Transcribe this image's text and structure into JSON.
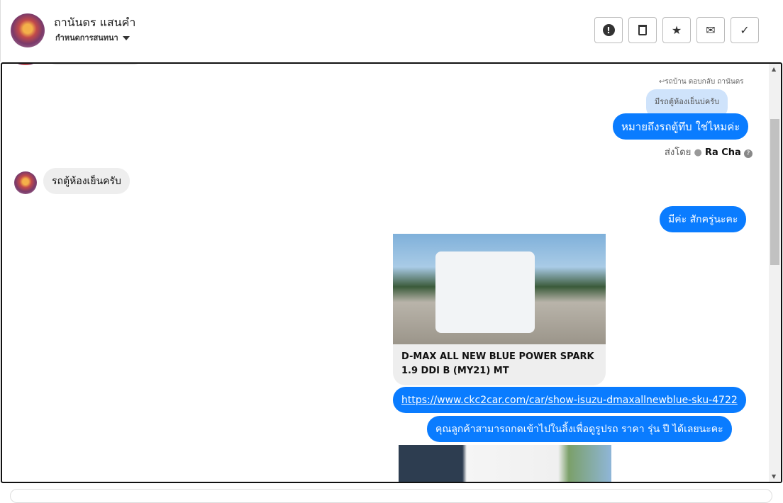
{
  "header": {
    "name": "ถานันดร แสนคำ",
    "subtitle": "กำหนดการสนทนา"
  },
  "toolbar": [
    {
      "icon": "alert-icon",
      "glyph": "!"
    },
    {
      "icon": "trash-icon",
      "glyph": "🗑"
    },
    {
      "icon": "star-icon",
      "glyph": "★"
    },
    {
      "icon": "mail-icon",
      "glyph": "✉"
    },
    {
      "icon": "check-icon",
      "glyph": "✓"
    }
  ],
  "messages": {
    "reply_label": "รถบ้าน ตอบกลับ ถานันดร",
    "quoted": "มีรถตู้ห้องเย็นบ่ครับ",
    "m1": "หมายถึงรถตู้ทึบ ใช่ไหมค่ะ",
    "sent_by_label": "ส่งโดย",
    "sent_by_name": "Ra Cha",
    "m2": "รถตู้ห้องเย็นครับ",
    "m3": "มีค่ะ สักครู่นะคะ",
    "card_title": "D-MAX ALL NEW BLUE POWER SPARK 1.9 DDI B (MY21) MT",
    "link": "https://www.ckc2car.com/car/show-isuzu-dmaxallnewblue-sku-4722",
    "m4": "คุณลูกค้าสามารถกดเข้าไปในลิ้งเพื่อดูรูปรถ ราคา รุ่น ปี ได้เลยนะคะ"
  }
}
